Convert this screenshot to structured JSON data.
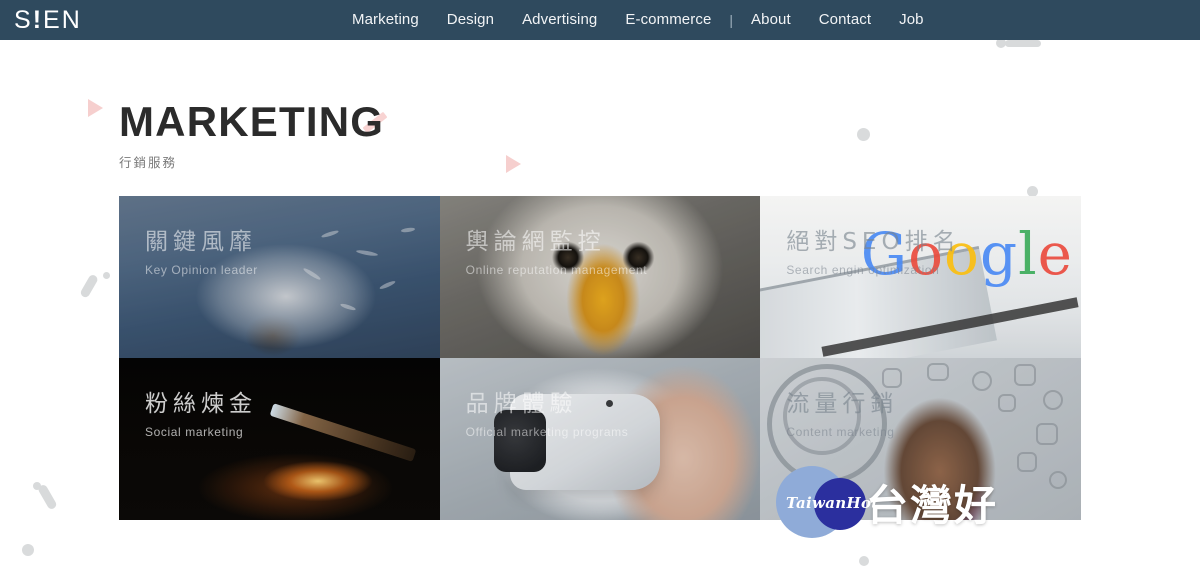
{
  "nav": {
    "logo": "S!EN",
    "links": [
      {
        "label": "Marketing"
      },
      {
        "label": "Design"
      },
      {
        "label": "Advertising"
      },
      {
        "label": "E-commerce"
      },
      {
        "label": "About"
      },
      {
        "label": "Contact"
      },
      {
        "label": "Job"
      }
    ],
    "separator": "|"
  },
  "header": {
    "title": "MARKETING",
    "subtitle": "行銷服務"
  },
  "cards": [
    {
      "cn": "關鍵風靡",
      "en": "Key Opinion leader"
    },
    {
      "cn": "輿論網監控",
      "en": "Online reputation management"
    },
    {
      "cn": "絕對SEO排名",
      "en": "Search engin optimization"
    },
    {
      "cn": "粉絲煉金",
      "en": "Social marketing"
    },
    {
      "cn": "品牌體驗",
      "en": "Official marketing programs"
    },
    {
      "cn": "流量行銷",
      "en": "Content marketing"
    }
  ],
  "card3_overlay": {
    "google_text": "oogle"
  },
  "watermark": {
    "brand": "TaiwanHot",
    "cn": "台灣好"
  },
  "colors": {
    "navbar": "#2f4a5e",
    "accent_pink": "#f6cfce",
    "title": "#2b2b2b",
    "subtitle": "#7a7a7a",
    "deco_gray": "#d9dbdc"
  }
}
